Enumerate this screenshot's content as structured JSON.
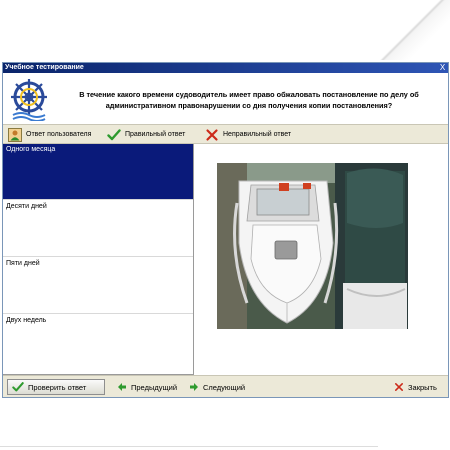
{
  "window": {
    "title": "Учебное тестирование",
    "close_glyph": "X"
  },
  "question": {
    "text": "В течение какого времени судоводитель имеет право обжаловать постановление по делу об административном правонарушении со дня получения копии постановления?",
    "logo_icon": "ship-wheel-icon"
  },
  "legend": {
    "user_answer": "Ответ пользователя",
    "correct_answer": "Правильный ответ",
    "wrong_answer": "Неправильный ответ",
    "user_icon": "user-icon",
    "correct_icon": "check-icon",
    "wrong_icon": "cross-icon"
  },
  "answers": [
    {
      "label": "Одного месяца",
      "selected": true
    },
    {
      "label": "Десяти дней",
      "selected": false
    },
    {
      "label": "Пяти дней",
      "selected": false
    },
    {
      "label": "Двух недель",
      "selected": false
    }
  ],
  "image": {
    "subject_icon": "motorboat-photo"
  },
  "bottom": {
    "check": "Проверить ответ",
    "previous": "Предыдущий",
    "next": "Следующий",
    "close": "Закрыть"
  },
  "colors": {
    "titlebar": "#0a246a",
    "selection": "#0a1a7a",
    "panel": "#ece9d8",
    "check_green": "#2e9a2e",
    "cross_red": "#cc2a1a"
  }
}
